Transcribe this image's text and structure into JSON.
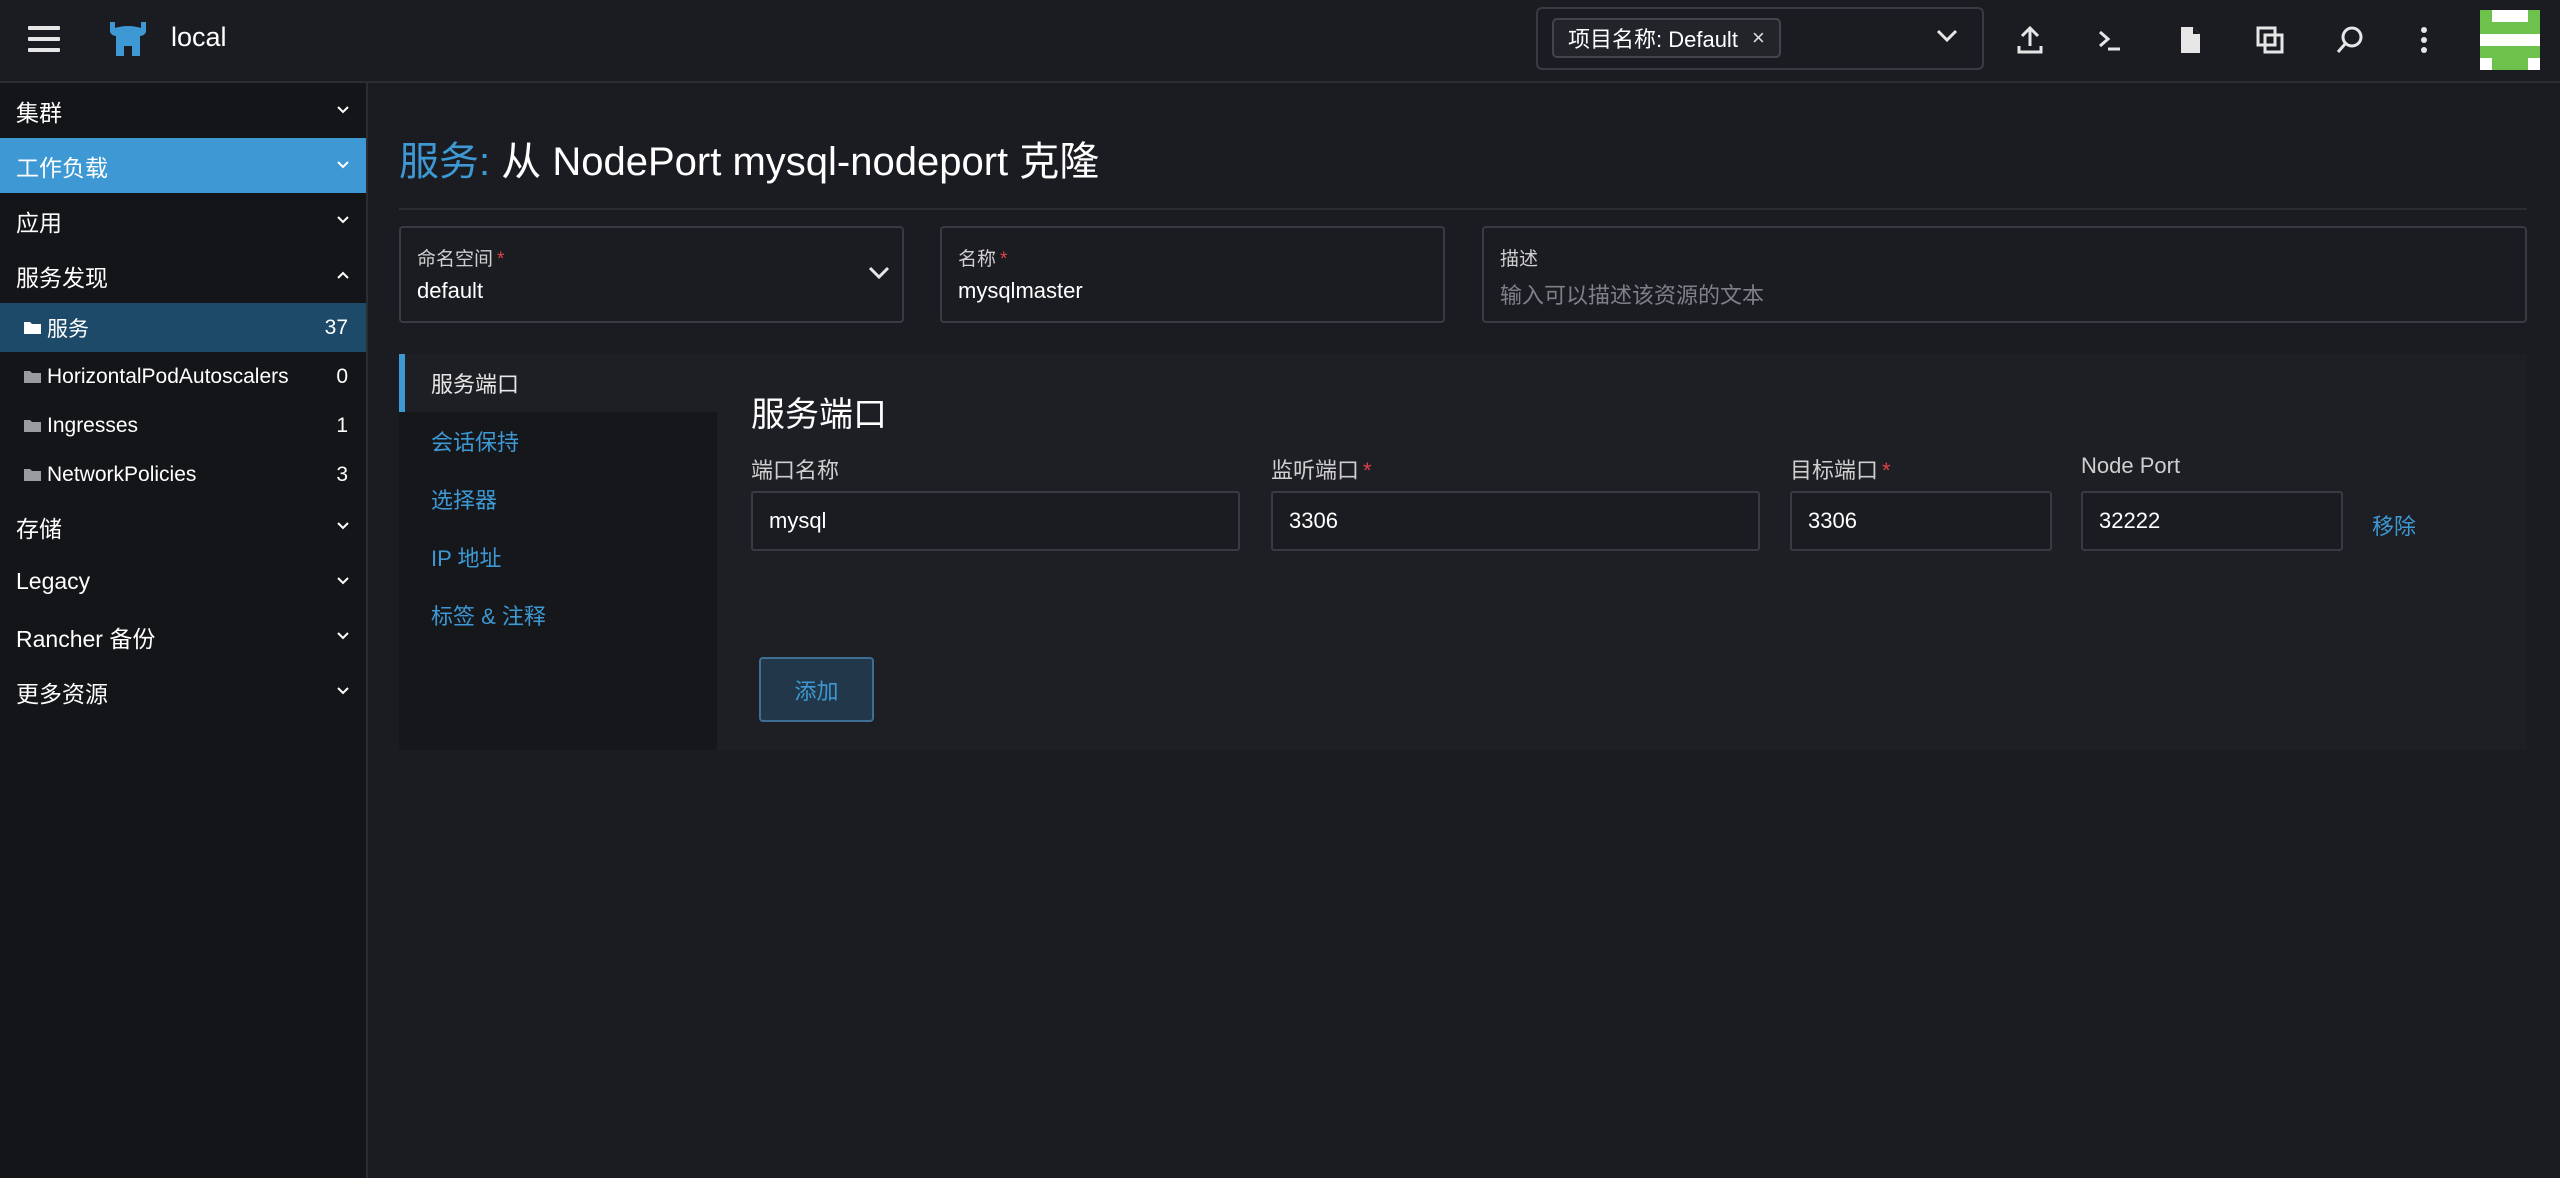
{
  "header": {
    "cluster_name": "local",
    "namespace_chip": "项目名称: Default",
    "namespace_chip_remove": "×"
  },
  "sidebar": {
    "groups": [
      {
        "label": "集群"
      },
      {
        "label": "工作负载"
      },
      {
        "label": "应用"
      },
      {
        "label": "服务发现"
      },
      {
        "label": "存储"
      },
      {
        "label": "Legacy"
      },
      {
        "label": "Rancher 备份"
      },
      {
        "label": "更多资源"
      }
    ],
    "service_discovery_items": [
      {
        "label": "服务",
        "count": "37"
      },
      {
        "label": "HorizontalPodAutoscalers",
        "count": "0"
      },
      {
        "label": "Ingresses",
        "count": "1"
      },
      {
        "label": "NetworkPolicies",
        "count": "3"
      }
    ]
  },
  "page": {
    "title_prefix": "服务:",
    "title_rest": "从 NodePort mysql-nodeport 克隆"
  },
  "form": {
    "namespace": {
      "label": "命名空间",
      "required": "*",
      "value": "default"
    },
    "name": {
      "label": "名称",
      "required": "*",
      "value": "mysqlmaster"
    },
    "description": {
      "label": "描述",
      "placeholder": "输入可以描述该资源的文本"
    }
  },
  "tabs": [
    {
      "label": "服务端口"
    },
    {
      "label": "会话保持"
    },
    {
      "label": "选择器"
    },
    {
      "label": "IP 地址"
    },
    {
      "label": "标签 & 注释"
    }
  ],
  "ports_section": {
    "title": "服务端口",
    "columns": {
      "port_name": "端口名称",
      "listen_port": "监听端口",
      "target_port": "目标端口",
      "node_port": "Node Port",
      "required": "*"
    },
    "row": {
      "port_name": "mysql",
      "listen_port": "3306",
      "target_port": "3306",
      "node_port": "32222"
    },
    "remove_label": "移除",
    "add_label": "添加"
  },
  "colors": {
    "accent": "#3d98d3",
    "background": "#1b1c21",
    "sidebar_bg": "#141519",
    "active_group": "#3d98d3",
    "active_item": "#1e4a6a",
    "required": "#e0414a"
  }
}
